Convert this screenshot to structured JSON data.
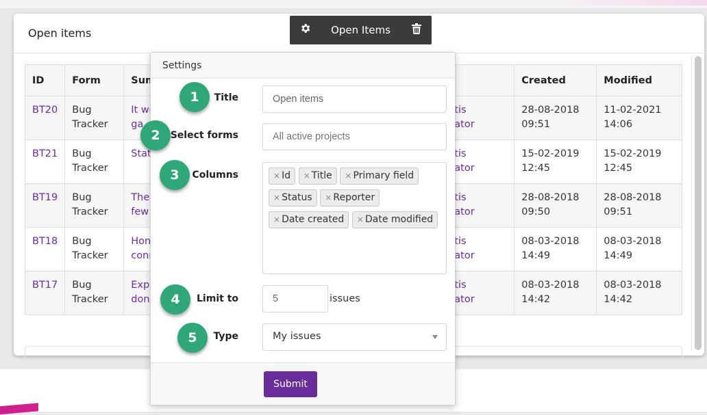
{
  "widget": {
    "title": "Open items"
  },
  "table": {
    "headers": [
      "ID",
      "Form",
      "Sum",
      "",
      "Created",
      "Modified"
    ],
    "rows": [
      {
        "id": "BT20",
        "form": [
          "Bug",
          "Tracker"
        ],
        "summary": [
          "It we",
          "ga"
        ],
        "reporter": [
          "tis",
          "ator"
        ],
        "created": [
          "28-08-2018",
          "09:51"
        ],
        "modified": [
          "11-02-2021",
          "14:06"
        ]
      },
      {
        "id": "BT21",
        "form": [
          "Bug",
          "Tracker"
        ],
        "summary": [
          "Stat",
          ""
        ],
        "reporter": [
          "tis",
          "ator"
        ],
        "created": [
          "15-02-2019",
          "12:45"
        ],
        "modified": [
          "15-02-2019",
          "12:45"
        ]
      },
      {
        "id": "BT19",
        "form": [
          "Bug",
          "Tracker"
        ],
        "summary": [
          "The",
          "few"
        ],
        "reporter": [
          "tis",
          "ator"
        ],
        "created": [
          "28-08-2018",
          "09:50"
        ],
        "modified": [
          "28-08-2018",
          "09:51"
        ]
      },
      {
        "id": "BT18",
        "form": [
          "Bug",
          "Tracker"
        ],
        "summary": [
          "Hon",
          "conr"
        ],
        "reporter": [
          "tis",
          "ator"
        ],
        "created": [
          "08-03-2018",
          "14:49"
        ],
        "modified": [
          "08-03-2018",
          "14:49"
        ]
      },
      {
        "id": "BT17",
        "form": [
          "Bug",
          "Tracker"
        ],
        "summary": [
          "Expe",
          "don'"
        ],
        "reporter": [
          "tis",
          "ator"
        ],
        "created": [
          "08-03-2018",
          "14:42"
        ],
        "modified": [
          "08-03-2018",
          "14:42"
        ]
      }
    ]
  },
  "toolbar": {
    "title": "Open Items",
    "settings_icon": "gear-icon",
    "delete_icon": "trash-icon",
    "background": "#3b3b3b"
  },
  "settings": {
    "heading": "Settings",
    "title_label": "Title",
    "title_value": "Open items",
    "forms_label": "Select forms",
    "forms_placeholder": "All active projects",
    "columns_label": "Columns",
    "columns": [
      "Id",
      "Title",
      "Primary field",
      "Status",
      "Reporter",
      "Date created",
      "Date modified"
    ],
    "limit_label": "Limit to",
    "limit_value": "5",
    "limit_unit": "issues",
    "type_label": "Type",
    "type_value": "My issues",
    "submit": "Submit"
  },
  "badges": [
    "1",
    "2",
    "3",
    "4",
    "5"
  ],
  "colors": {
    "accent": "#6a2c9a",
    "badge": "#2fa77a",
    "link": "#6a2c9a"
  }
}
